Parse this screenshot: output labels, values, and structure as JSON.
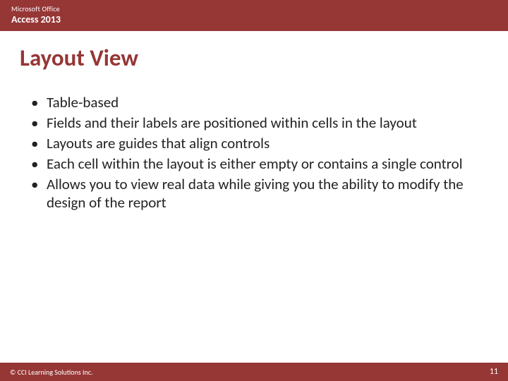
{
  "header": {
    "small": "Microsoft Office",
    "big": "Access 2013"
  },
  "title": "Layout View",
  "bullets": [
    "Table-based",
    "Fields and their labels are positioned within cells in the layout",
    "Layouts are guides that align controls",
    "Each cell within the layout is either empty or contains a single control",
    "Allows you to view real data while giving you the ability to modify the design of the report"
  ],
  "footer": {
    "copyright": "© CCI Learning Solutions Inc.",
    "page": "11"
  }
}
